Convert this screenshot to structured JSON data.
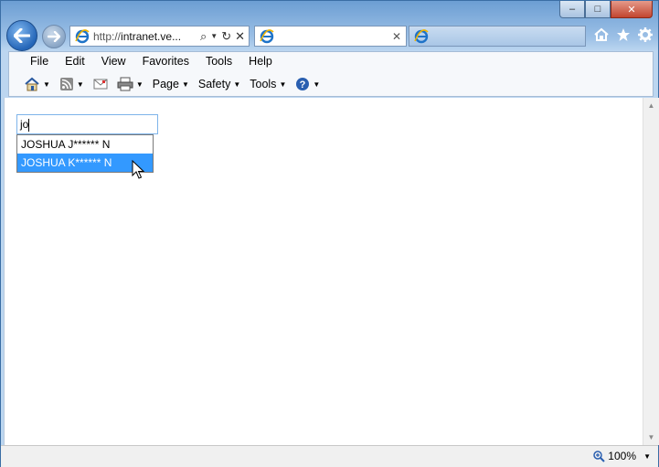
{
  "window": {
    "caption_buttons": {
      "minimize": "–",
      "maximize": "□",
      "close": "✕"
    }
  },
  "address_bar": {
    "url_prefix": "http://",
    "url_host": "intranet.ve..."
  },
  "tabs": [
    {
      "label": "",
      "active": true,
      "close": "✕"
    },
    {
      "label": "",
      "active": false
    }
  ],
  "menu_bar": [
    "File",
    "Edit",
    "View",
    "Favorites",
    "Tools",
    "Help"
  ],
  "command_bar": {
    "page_label": "Page",
    "safety_label": "Safety",
    "tools_label": "Tools"
  },
  "search": {
    "value": "jo",
    "suggestions": [
      {
        "text": "JOSHUA J****** N",
        "selected": false
      },
      {
        "text": "JOSHUA K****** N",
        "selected": true
      }
    ]
  },
  "status_bar": {
    "zoom": "100%"
  },
  "colors": {
    "selection": "#3399ff",
    "frame": "#6c9ed3"
  }
}
